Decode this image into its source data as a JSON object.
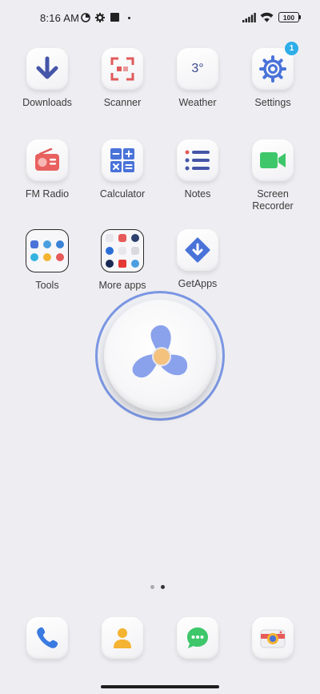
{
  "status_bar": {
    "time": "8:16 AM",
    "battery": "100",
    "icons": [
      "data-saver-icon",
      "gear-icon",
      "square-icon",
      "dot-icon",
      "signal-icon",
      "wifi-icon",
      "battery-icon"
    ]
  },
  "apps": [
    {
      "label": "Downloads",
      "icon": "download-arrow-icon"
    },
    {
      "label": "Scanner",
      "icon": "scanner-frame-icon"
    },
    {
      "label": "Weather",
      "icon": "weather-icon",
      "temp": "3°"
    },
    {
      "label": "Settings",
      "icon": "gear-icon",
      "badge": "1"
    },
    {
      "label": "FM Radio",
      "icon": "radio-icon"
    },
    {
      "label": "Calculator",
      "icon": "calculator-icon"
    },
    {
      "label": "Notes",
      "icon": "notes-list-icon"
    },
    {
      "label": "Screen\nRecorder",
      "icon": "video-camera-icon"
    },
    {
      "label": "Tools",
      "icon": "folder-icon"
    },
    {
      "label": "More apps",
      "icon": "folder-icon"
    },
    {
      "label": "GetApps",
      "icon": "getapps-icon"
    }
  ],
  "widget": {
    "name": "fan-widget",
    "icon": "fan-icon"
  },
  "page_indicator": {
    "pages": 2,
    "active": 2
  },
  "dock": [
    {
      "icon": "phone-icon"
    },
    {
      "icon": "contacts-icon"
    },
    {
      "icon": "messages-icon"
    },
    {
      "icon": "camera-icon"
    }
  ],
  "colors": {
    "background": "#eeeef2",
    "accent_blue": "#4a73d9",
    "badge": "#2eaee8",
    "red": "#e65a5a",
    "green": "#3ec76a",
    "orange": "#f4b331"
  }
}
